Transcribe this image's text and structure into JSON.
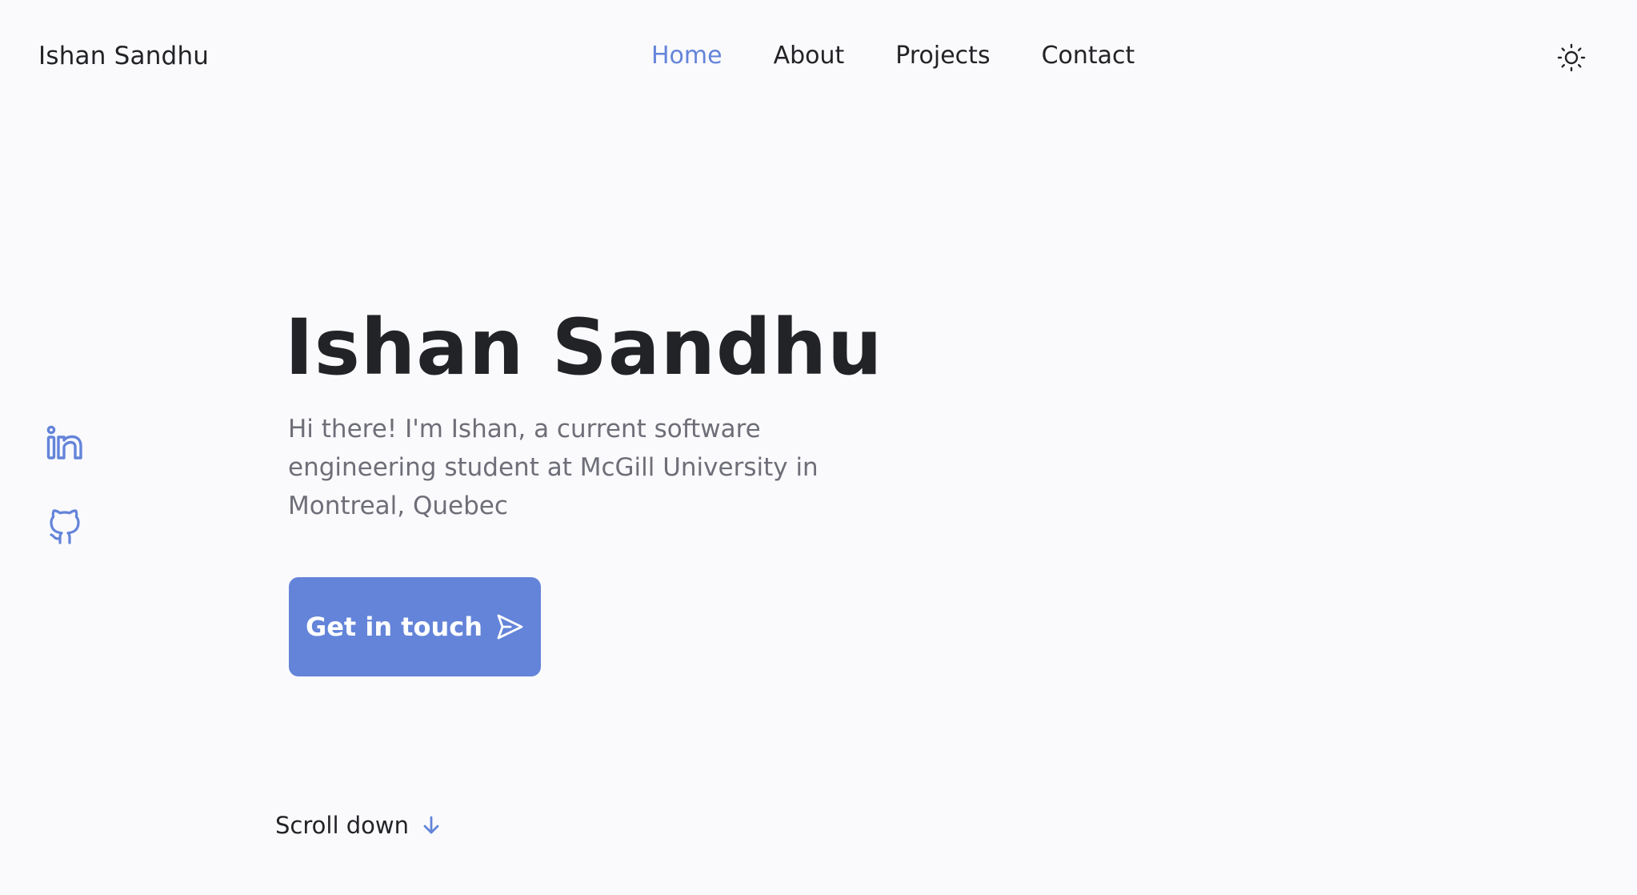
{
  "header": {
    "brand": "Ishan Sandhu",
    "nav": [
      {
        "label": "Home",
        "active": true
      },
      {
        "label": "About",
        "active": false
      },
      {
        "label": "Projects",
        "active": false
      },
      {
        "label": "Contact",
        "active": false
      }
    ],
    "theme_toggle_icon": "sun-icon"
  },
  "social": [
    {
      "icon": "linkedin-icon"
    },
    {
      "icon": "github-icon"
    }
  ],
  "hero": {
    "title": "Ishan Sandhu",
    "description": "Hi there! I'm Ishan, a current software engineering student at McGill University in Montreal, Quebec",
    "cta_label": "Get in touch",
    "cta_icon": "send-icon"
  },
  "scroll": {
    "label": "Scroll down",
    "icon": "arrow-down-icon"
  },
  "colors": {
    "accent": "#6484D9",
    "text": "#222326",
    "muted": "#6E6E78",
    "background": "#FAFAFD"
  }
}
